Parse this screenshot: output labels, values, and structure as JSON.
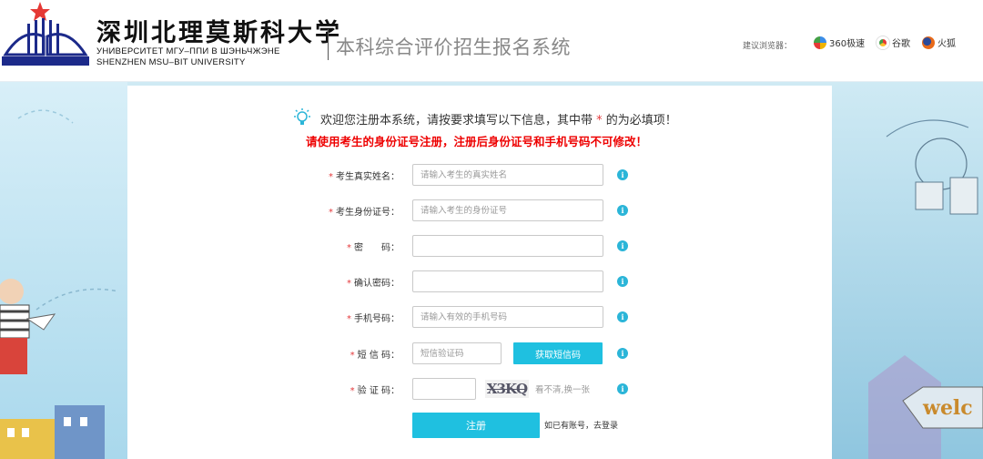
{
  "header": {
    "university_cn": "深圳北理莫斯科大学",
    "university_ru": "УНИВЕРСИТЕТ МГУ–ППИ В ШЭНЬЧЖЭНЕ",
    "university_en": "SHENZHEN MSU–BIT UNIVERSITY",
    "system_title": "本科综合评价招生报名系统",
    "browser_hint": "建议浏览器：",
    "browsers": [
      {
        "label": "360极速",
        "icon": "360-browser-icon"
      },
      {
        "label": "谷歌",
        "icon": "chrome-icon"
      },
      {
        "label": "火狐",
        "icon": "firefox-icon"
      }
    ]
  },
  "intro": {
    "welcome_before": "欢迎您注册本系统，请按要求填写以下信息，其中带",
    "welcome_star": "*",
    "welcome_after": "的为必填项！",
    "warning": "请使用考生的身份证号注册，注册后身份证号和手机号码不可修改！"
  },
  "form": {
    "required_mark": "*",
    "info_glyph": "i",
    "fields": [
      {
        "label": "考生真实姓名：",
        "placeholder": "请输入考生的真实姓名"
      },
      {
        "label": "考生身份证号：",
        "placeholder": "请输入考生的身份证号"
      },
      {
        "label": "密　　码：",
        "placeholder": ""
      },
      {
        "label": "确认密码：",
        "placeholder": ""
      },
      {
        "label": "手机号码：",
        "placeholder": "请输入有效的手机号码"
      },
      {
        "label": "短 信 码：",
        "placeholder": "短信验证码"
      },
      {
        "label": "验 证 码：",
        "placeholder": ""
      }
    ],
    "sms_button": "获取短信码",
    "captcha_text": "X3KQ",
    "refresh_text": "看不清,换一张",
    "submit": "注册",
    "login_link": "如已有账号，去登录"
  },
  "colors": {
    "accent": "#1fc0e0",
    "required": "#e4393c",
    "warning": "#ee0000",
    "background": "#cfeaf4"
  }
}
